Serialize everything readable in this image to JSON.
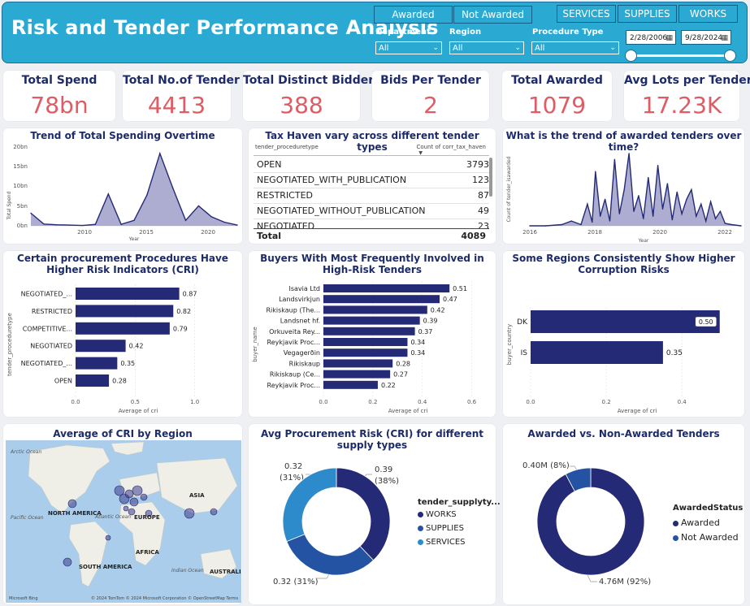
{
  "header": {
    "title": "Risk and Tender Performance Analysis",
    "status_buttons": [
      "Awarded",
      "Not Awarded"
    ],
    "type_buttons": [
      "SERVICES",
      "SUPPLIES",
      "WORKS"
    ],
    "filters": [
      {
        "label": "Department",
        "value": "All"
      },
      {
        "label": "Region",
        "value": "All"
      },
      {
        "label": "Procedure Type",
        "value": "All"
      }
    ],
    "date_start": "2/28/2006",
    "date_end": "9/28/2024",
    "date_range_fraction": [
      0.0,
      1.0
    ]
  },
  "kpis": [
    {
      "label": "Total Spend",
      "value": "78bn"
    },
    {
      "label": "Total No.of Tender",
      "value": "4413"
    },
    {
      "label": "Total Distinct Bidder",
      "value": "388"
    },
    {
      "label": "Bids Per Tender",
      "value": "2"
    },
    {
      "label": "Total Awarded",
      "value": "1079"
    },
    {
      "label": "Avg Lots per Tender",
      "value": "17.23K"
    }
  ],
  "colors": {
    "accent": "#2aaad2",
    "navy": "#242a75",
    "mid_blue": "#2553a4",
    "light_blue": "#2e8bcb",
    "kpi_red": "#e05b63",
    "area_fill": "#9f9fc9"
  },
  "spend_trend": {
    "title": "Trend of Total Spending Overtime",
    "ylabel": "Total Spend",
    "xlabel": "Year",
    "yticks": [
      "0bn",
      "5bn",
      "10bn",
      "15bn",
      "20bn"
    ],
    "xticks": [
      "2010",
      "2015",
      "2020"
    ]
  },
  "tax_table": {
    "title": "Tax Haven vary across different tender types",
    "col1": "tender_proceduretype",
    "col2": "Count of corr_tax_haven",
    "rows": [
      {
        "name": "OPEN",
        "value": "3793"
      },
      {
        "name": "NEGOTIATED_WITH_PUBLICATION",
        "value": "123"
      },
      {
        "name": "RESTRICTED",
        "value": "87"
      },
      {
        "name": "NEGOTIATED_WITHOUT_PUBLICATION",
        "value": "49"
      },
      {
        "name": "NEGOTIATED",
        "value": "23"
      }
    ],
    "total_label": "Total",
    "total_value": "4089"
  },
  "awarded_trend": {
    "title": "What is the trend of awarded tenders over time?",
    "ylabel": "Count of tender_isawarded",
    "xlabel": "Year",
    "xticks": [
      "2016",
      "2018",
      "2020",
      "2022"
    ]
  },
  "cri_proc": {
    "title": "Certain procurement Procedures Have Higher Risk Indicators (CRI)",
    "ylabel": "tender_proceduretype",
    "xlabel": "Average of cri",
    "xticks": [
      "0.0",
      "0.5",
      "1.0"
    ]
  },
  "buyers": {
    "title": "Buyers With Most Frequently Involved in High-Risk Tenders",
    "ylabel": "buyer_name",
    "xlabel": "Average of cri",
    "xticks": [
      "0.0",
      "0.2",
      "0.4",
      "0.6"
    ]
  },
  "regions": {
    "title": "Some Regions Consistently Show Higher Corruption Risks",
    "ylabel": "buyer_country",
    "xlabel": "Average of cri",
    "xticks": [
      "0.0",
      "0.2",
      "0.4"
    ]
  },
  "map": {
    "title": "Average of CRI by Region",
    "labels": [
      "Arctic Ocean",
      "NORTH AMERICA",
      "EUROPE",
      "ASIA",
      "Pacific Ocean",
      "Atlantic Ocean",
      "AFRICA",
      "SOUTH AMERICA",
      "Indian Ocean",
      "AUSTRALIA"
    ],
    "attribution": "© 2024 TomTom © 2024 Microsoft Corporation © OpenStreetMap  Terms",
    "logo": "Microsoft Bing"
  },
  "supply_donut": {
    "title": "Avg Procurement Risk (CRI) for different supply types",
    "legend_title": "tender_supplyty...",
    "labels": [
      "0.39 (38%)",
      "0.32 (31%)",
      "0.32 (31%)"
    ]
  },
  "award_donut": {
    "title": "Awarded vs. Non-Awarded Tenders",
    "legend_title": "AwardedStatus",
    "labels": [
      "4.76M (92%)",
      "0.40M (8%)"
    ]
  },
  "chart_data": [
    {
      "type": "area",
      "title": "Trend of Total Spending Overtime",
      "xlabel": "Year",
      "ylabel": "Total Spend",
      "x": [
        2006,
        2007,
        2008,
        2009,
        2010,
        2011,
        2012,
        2013,
        2014,
        2015,
        2016,
        2017,
        2018,
        2019,
        2020,
        2021,
        2022
      ],
      "series": [
        {
          "values": [
            3.5,
            0.5,
            0.3,
            0.2,
            0.1,
            0.4,
            8.8,
            0.4,
            1.5,
            8.5,
            20.0,
            10.5,
            1.5,
            5.5,
            2.5,
            1.0,
            0.2
          ]
        }
      ],
      "ylim": [
        0,
        22
      ],
      "xlim": [
        2006,
        2022
      ]
    },
    {
      "type": "area",
      "title": "What is the trend of awarded tenders over time?",
      "xlabel": "Year",
      "ylabel": "Count of tender_isawarded",
      "x": [
        2016.0,
        2016.5,
        2017.0,
        2017.3,
        2017.6,
        2017.8,
        2017.95,
        2018.05,
        2018.2,
        2018.35,
        2018.5,
        2018.65,
        2018.8,
        2018.95,
        2019.1,
        2019.25,
        2019.4,
        2019.55,
        2019.7,
        2019.85,
        2020.0,
        2020.15,
        2020.3,
        2020.45,
        2020.6,
        2020.75,
        2020.9,
        2021.05,
        2021.2,
        2021.35,
        2021.5,
        2021.65,
        2021.8,
        2021.95,
        2022.1,
        2022.3,
        2022.6
      ],
      "series": [
        {
          "values": [
            0,
            0,
            1,
            4,
            1,
            18,
            3,
            45,
            8,
            22,
            4,
            55,
            10,
            30,
            60,
            12,
            25,
            6,
            40,
            8,
            50,
            14,
            35,
            5,
            28,
            10,
            22,
            30,
            8,
            18,
            4,
            20,
            6,
            12,
            2,
            1,
            0
          ]
        }
      ]
    },
    {
      "type": "bar",
      "title": "Certain procurement Procedures Have Higher Risk Indicators (CRI)",
      "xlabel": "Average of cri",
      "ylabel": "tender_proceduretype",
      "categories": [
        "NEGOTIATED_...",
        "RESTRICTED",
        "COMPETITIVE...",
        "NEGOTIATED",
        "NEGOTIATED_...",
        "OPEN"
      ],
      "values": [
        0.87,
        0.82,
        0.79,
        0.42,
        0.35,
        0.28
      ],
      "xlim": [
        0,
        1.2
      ]
    },
    {
      "type": "bar",
      "title": "Buyers With Most Frequently Involved in High-Risk Tenders",
      "xlabel": "Average of cri",
      "ylabel": "buyer_name",
      "categories": [
        "Isavia Ltd",
        "Landsvirkjun",
        "Rikiskaup (The...",
        "Landsnet hf.",
        "Orkuveita Rey...",
        "Reykjavik Proc...",
        "Vegagerðin",
        "Rikiskaup",
        "Rikiskaup (Ce...",
        "Reykjavik Proc..."
      ],
      "values": [
        0.51,
        0.47,
        0.42,
        0.39,
        0.37,
        0.34,
        0.34,
        0.28,
        0.27,
        0.22
      ],
      "xlim": [
        0,
        0.7
      ]
    },
    {
      "type": "bar",
      "title": "Some Regions Consistently Show Higher Corruption Risks",
      "xlabel": "Average of cri",
      "ylabel": "buyer_country",
      "categories": [
        "DK",
        "IS"
      ],
      "values": [
        0.5,
        0.35
      ],
      "xlim": [
        0,
        0.55
      ]
    },
    {
      "type": "pie",
      "title": "Avg Procurement Risk (CRI) for different supply types",
      "categories": [
        "WORKS",
        "SUPPLIES",
        "SERVICES"
      ],
      "values": [
        0.39,
        0.32,
        0.32
      ],
      "percent": [
        38,
        31,
        31
      ]
    },
    {
      "type": "pie",
      "title": "Awarded vs. Non-Awarded Tenders",
      "categories": [
        "Awarded",
        "Not Awarded"
      ],
      "values": [
        4.76,
        0.4
      ],
      "percent": [
        92,
        8
      ]
    }
  ]
}
